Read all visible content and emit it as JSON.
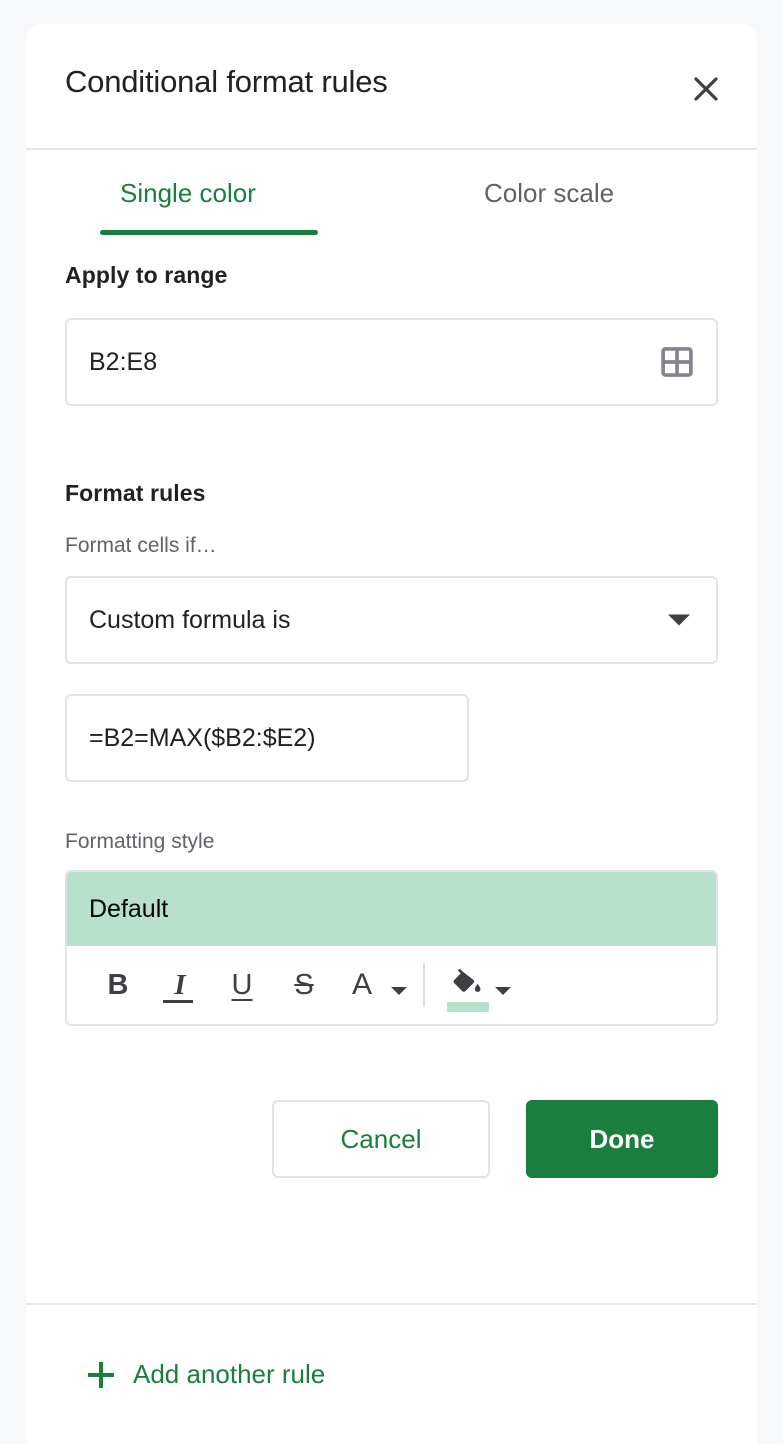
{
  "dialog": {
    "title": "Conditional format rules",
    "close_icon": "close-icon"
  },
  "tabs": [
    {
      "label": "Single color",
      "active": true
    },
    {
      "label": "Color scale",
      "active": false
    }
  ],
  "apply_to_range": {
    "label": "Apply to range",
    "value": "B2:E8",
    "picker_icon": "grid-range-picker-icon"
  },
  "format_rules": {
    "label": "Format rules",
    "condition_label": "Format cells if…",
    "condition_value": "Custom formula is",
    "formula_value": "=B2=MAX($B2:$E2)"
  },
  "formatting_style": {
    "label": "Formatting style",
    "preview_text": "Default",
    "preview_bg": "#b7e1cd",
    "toolbar": {
      "bold": "B",
      "italic": "I",
      "underline": "U",
      "strikethrough": "S",
      "text_color": "A",
      "fill_icon": "fill-color-bucket-icon",
      "fill_swatch": "#b7e1cd"
    }
  },
  "actions": {
    "cancel_label": "Cancel",
    "done_label": "Done"
  },
  "footer": {
    "add_rule_label": "Add another rule",
    "plus_icon": "plus-icon"
  },
  "colors": {
    "accent_green": "#1a7e3e",
    "light_green": "#b7e1cd",
    "text_primary": "#202124",
    "text_secondary": "#5f6368",
    "border": "#e0e2e6",
    "page_bg": "#f6f8fa"
  }
}
